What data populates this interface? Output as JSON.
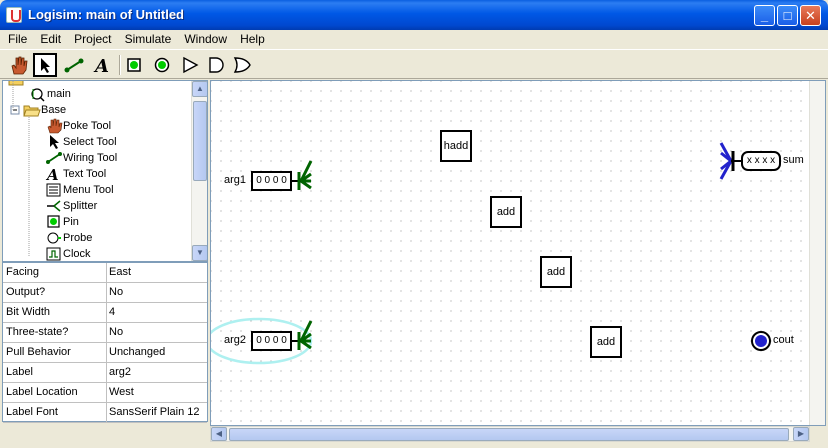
{
  "window": {
    "title": "Logisim: main of Untitled",
    "minimize": "_",
    "maximize": "□",
    "close": "✕"
  },
  "menu": [
    "File",
    "Edit",
    "Project",
    "Simulate",
    "Window",
    "Help"
  ],
  "toolbar": {
    "tools": [
      "hand-icon",
      "arrow-icon",
      "wire-icon",
      "text-icon",
      "input-pin-icon",
      "output-pin-icon",
      "buffer-icon",
      "and-gate-icon",
      "or-gate-icon"
    ],
    "selected": "arrow-icon"
  },
  "explorer": {
    "items": [
      {
        "label": "main",
        "icon": "circuit-icon"
      },
      {
        "label": "Base",
        "icon": "folder-icon"
      },
      {
        "label": "Poke Tool",
        "icon": "hand-icon"
      },
      {
        "label": "Select Tool",
        "icon": "arrow-icon"
      },
      {
        "label": "Wiring Tool",
        "icon": "wire-icon"
      },
      {
        "label": "Text Tool",
        "icon": "text-icon"
      },
      {
        "label": "Menu Tool",
        "icon": "menu-icon"
      },
      {
        "label": "Splitter",
        "icon": "splitter-icon"
      },
      {
        "label": "Pin",
        "icon": "pin-icon"
      },
      {
        "label": "Probe",
        "icon": "probe-icon"
      },
      {
        "label": "Clock",
        "icon": "clock-icon"
      }
    ]
  },
  "attributes": [
    {
      "key": "Facing",
      "value": "East"
    },
    {
      "key": "Output?",
      "value": "No"
    },
    {
      "key": "Bit Width",
      "value": "4"
    },
    {
      "key": "Three-state?",
      "value": "No"
    },
    {
      "key": "Pull Behavior",
      "value": "Unchanged"
    },
    {
      "key": "Label",
      "value": "arg2"
    },
    {
      "key": "Label Location",
      "value": "West"
    },
    {
      "key": "Label Font",
      "value": "SansSerif Plain 12"
    }
  ],
  "circuit": {
    "inputs": [
      {
        "label": "arg1",
        "value": "0 0 0 0"
      },
      {
        "label": "arg2",
        "value": "0 0 0 0"
      }
    ],
    "components": [
      "hadd",
      "add",
      "add",
      "add"
    ],
    "outputs": [
      {
        "label": "sum",
        "value": "x x x x"
      },
      {
        "label": "cout"
      }
    ]
  },
  "colors": {
    "title_bar": "#0058e6",
    "wire_green": "#006400",
    "wire_blue": "#2222cc",
    "selection": "#aef0f0"
  }
}
